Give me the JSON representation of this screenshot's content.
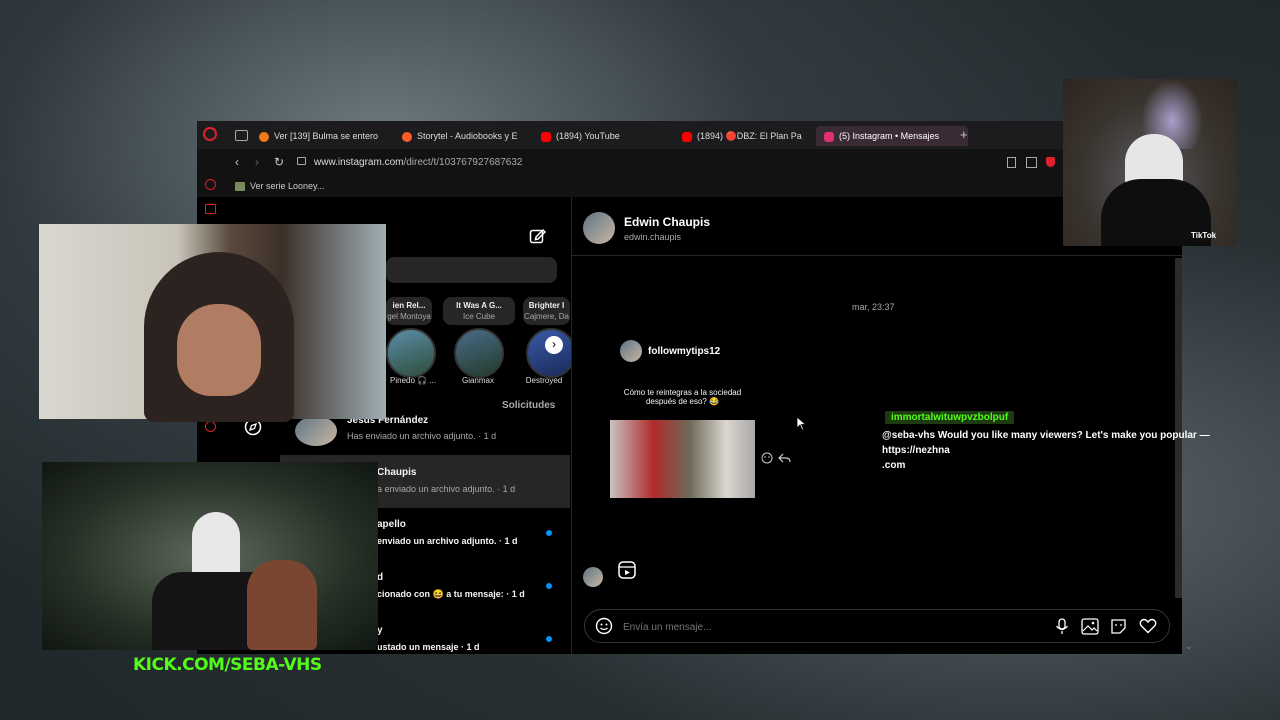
{
  "browser": {
    "tabs": [
      {
        "label": "Ver [139] Bulma se entero",
        "color": "#f27a1a"
      },
      {
        "label": "Storytel - Audiobooks y E",
        "color": "#ff5c28"
      },
      {
        "label": "(1894) YouTube",
        "color": "#ff0000"
      },
      {
        "label": "(1894) 🔴DBZ: El Plan Pa",
        "color": "#ff0000"
      },
      {
        "label": "(5) Instagram • Mensajes",
        "color": "#e1306c"
      }
    ],
    "url_host": "www.instagram.com",
    "url_path": "/direct/t/103767927687632",
    "bookmark": "Ver serie Looney..."
  },
  "inbox": {
    "stories_chips": [
      {
        "title": "ien Rel...",
        "sub": "gel Montoya"
      },
      {
        "title": "It Was A G...",
        "sub": "Ice Cube"
      },
      {
        "title": "Brighter I",
        "sub": "Cajmere, Da"
      }
    ],
    "stories_names": [
      "Pinedo 🎧 ...",
      "Gianmax",
      "Destroyed"
    ],
    "requests_label": "Solicitudes",
    "conversations": [
      {
        "name": "Jesús Fernández",
        "preview": "Has enviado un archivo adjunto. · 1 d"
      },
      {
        "name": "Chaupis",
        "preview": "a enviado un archivo adjunto. · 1 d"
      },
      {
        "name": "apello",
        "preview": "enviado un archivo adjunto. · 1 d"
      },
      {
        "name": "d",
        "preview": "cionado con 😆 a tu mensaje: · 1 d"
      },
      {
        "name": "y",
        "preview": "ustado un mensaje · 1 d"
      }
    ]
  },
  "thread": {
    "name": "Edwin Chaupis",
    "username": "edwin.chaupis",
    "timestamp": "mar, 23:37",
    "shared_user": "followmytips12",
    "shared_caption_1": "Cómo te reintegras a la sociedad",
    "shared_caption_2": "después de eso? 😂",
    "composer_placeholder": "Envía un mensaje..."
  },
  "stream_chat": {
    "username": "immortalwituwpvzbolpuf",
    "message_line1": "@seba-vhs Would you like many viewers? Let's make you popular — https://nezhna",
    "message_line2": ".com",
    "username_color": "#53fc18"
  },
  "overlay": {
    "kick_label": "KICK.COM/SEBA-VHS",
    "tiktok_label": "TikTok"
  }
}
